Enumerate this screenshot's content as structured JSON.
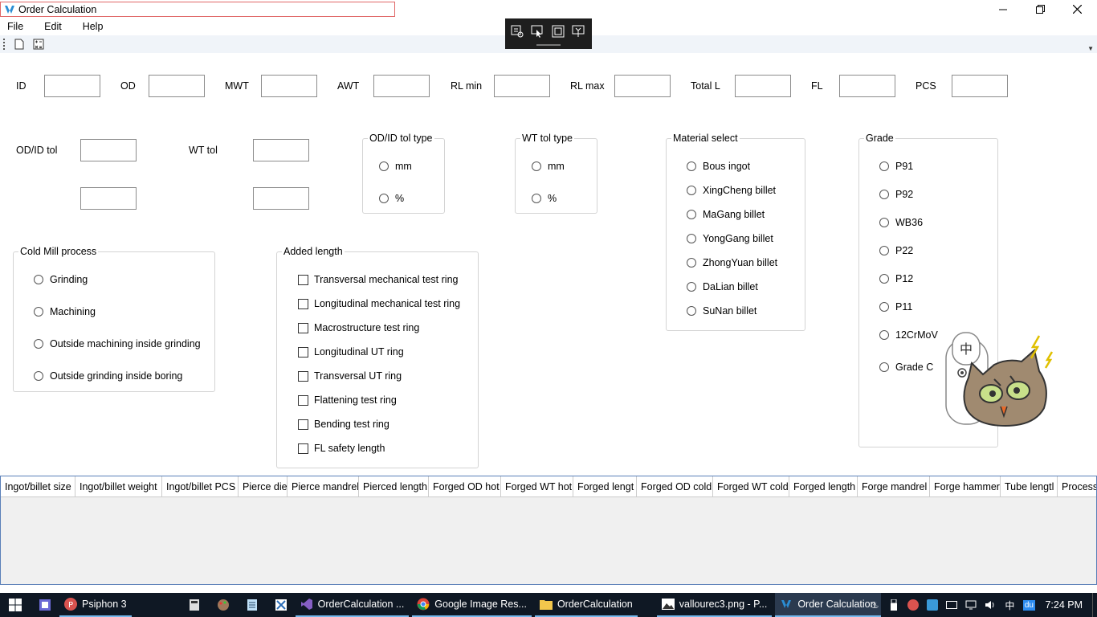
{
  "window": {
    "title": "Order Calculation",
    "minimize_glyph": "—",
    "maximize_glyph": "❐",
    "close_glyph": "✕"
  },
  "menu": [
    "File",
    "Edit",
    "Help"
  ],
  "inputs_row1": [
    {
      "label": "ID",
      "value": ""
    },
    {
      "label": "OD",
      "value": ""
    },
    {
      "label": "MWT",
      "value": ""
    },
    {
      "label": "AWT",
      "value": ""
    },
    {
      "label": "RL min",
      "value": ""
    },
    {
      "label": "RL max",
      "value": ""
    },
    {
      "label": "Total L",
      "value": ""
    },
    {
      "label": "FL",
      "value": ""
    },
    {
      "label": "PCS",
      "value": ""
    }
  ],
  "tolerances": {
    "od_id_tol_label": "OD/ID tol",
    "wt_tol_label": "WT tol"
  },
  "od_id_tol_type": {
    "title": "OD/ID tol type",
    "options": [
      "mm",
      "%"
    ]
  },
  "wt_tol_type": {
    "title": "WT tol type",
    "options": [
      "mm",
      "%"
    ]
  },
  "material_select": {
    "title": "Material select",
    "options": [
      "Bous ingot",
      "XingCheng billet",
      "MaGang billet",
      "YongGang billet",
      "ZhongYuan billet",
      "DaLian billet",
      "SuNan billet"
    ]
  },
  "grade": {
    "title": "Grade",
    "options": [
      "P91",
      "P92",
      "WB36",
      "P22",
      "P12",
      "P11",
      "12CrMoV",
      "Grade C"
    ]
  },
  "cold_mill": {
    "title": "Cold Mill process",
    "options": [
      "Grinding",
      "Machining",
      "Outside machining inside grinding",
      "Outside grinding inside boring"
    ]
  },
  "added_length": {
    "title": "Added length",
    "options": [
      "Transversal mechanical test ring",
      "Longitudinal mechanical test ring",
      "Macrostructure test ring",
      "Longitudinal UT ring",
      "Transversal UT ring",
      "Flattening test ring",
      "Bending test ring",
      "FL safety length"
    ]
  },
  "grid_columns": [
    "Ingot/billet size",
    "Ingot/billet weight",
    "Ingot/billet PCS",
    "Pierce die",
    "Pierce mandrel",
    "Pierced length",
    "Forged OD hot",
    "Forged WT hot",
    "Forged lengt",
    "Forged OD cold",
    "Forged WT cold",
    "Forged length",
    "Forge mandrel",
    "Forge hammer",
    "Tube lengtl",
    "Process"
  ],
  "taskbar": {
    "apps": [
      {
        "label": "Psiphon 3",
        "icon": "psiphon-icon"
      },
      {
        "label": "OrderCalculation ...",
        "icon": "visual-studio-icon"
      },
      {
        "label": "Google Image Res...",
        "icon": "chrome-icon"
      },
      {
        "label": "OrderCalculation",
        "icon": "folder-icon"
      },
      {
        "label": "vallourec3.png - P...",
        "icon": "image-viewer-icon"
      },
      {
        "label": "Order Calculation",
        "icon": "app-icon"
      }
    ],
    "tray_ime": "中",
    "tray_du": "du",
    "clock": "7:24 PM"
  }
}
